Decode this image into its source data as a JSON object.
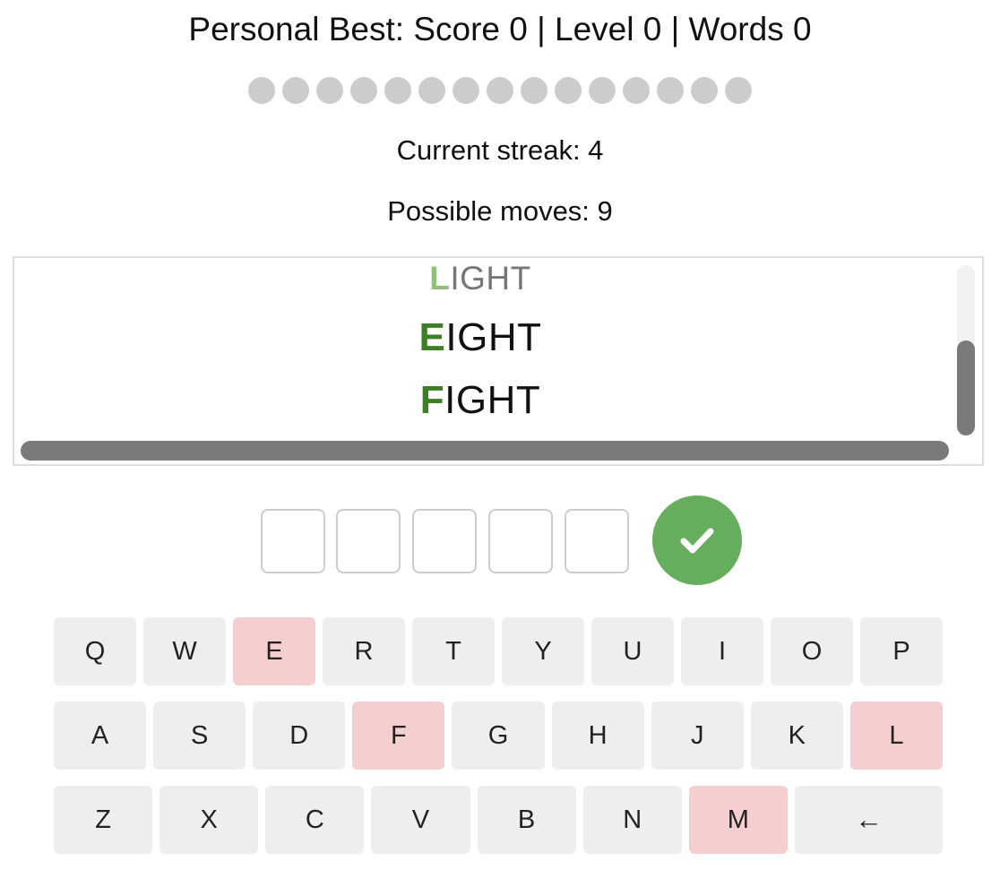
{
  "personal_best": "Personal Best: Score 0 | Level 0 | Words 0",
  "progress": {
    "total_dots": 15,
    "filled_dots": 0
  },
  "streak": "Current streak: 4",
  "moves": "Possible moves: 9",
  "words": [
    {
      "first": "L",
      "rest": "IGHT",
      "faded": true
    },
    {
      "first": "E",
      "rest": "IGHT",
      "faded": false
    },
    {
      "first": "F",
      "rest": "IGHT",
      "faded": false
    }
  ],
  "input_letters": [
    "",
    "",
    "",
    "",
    ""
  ],
  "keyboard": {
    "row1": [
      "Q",
      "W",
      "E",
      "R",
      "T",
      "Y",
      "U",
      "I",
      "O",
      "P"
    ],
    "row2": [
      "A",
      "S",
      "D",
      "F",
      "G",
      "H",
      "J",
      "K",
      "L"
    ],
    "row3": [
      "Z",
      "X",
      "C",
      "V",
      "B",
      "N",
      "M"
    ],
    "backspace": "←",
    "highlighted_keys": [
      "E",
      "F",
      "L",
      "M"
    ]
  },
  "colors": {
    "accent_green": "#66ad5d",
    "word_letter_green": "#3d7f24",
    "used_key": "#f5cfcf",
    "key_bg": "#eeeeee",
    "dot_empty": "#cccccc"
  },
  "icons": {
    "submit": "check-icon",
    "backspace": "backspace-arrow-icon"
  }
}
